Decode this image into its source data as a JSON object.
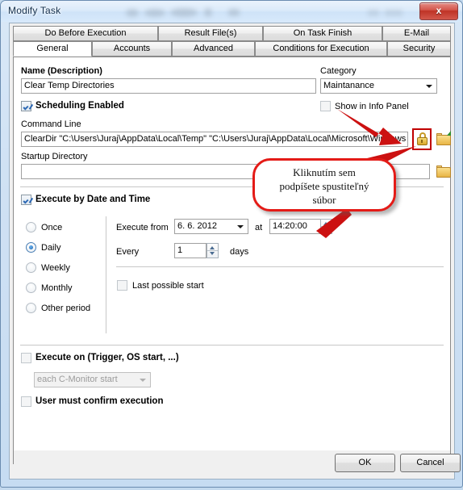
{
  "window": {
    "title": "Modify Task",
    "close_label": "x"
  },
  "tabs": {
    "row_top": [
      {
        "label": "Do Before Execution",
        "active": false
      },
      {
        "label": "Result File(s)",
        "active": false
      },
      {
        "label": "On Task Finish",
        "active": false
      },
      {
        "label": "E-Mail",
        "active": false
      }
    ],
    "row_bottom": [
      {
        "label": "General",
        "active": true
      },
      {
        "label": "Accounts",
        "active": false
      },
      {
        "label": "Advanced",
        "active": false
      },
      {
        "label": "Conditions for Execution",
        "active": false
      },
      {
        "label": "Security",
        "active": false
      }
    ]
  },
  "general": {
    "name_label": "Name (Description)",
    "name_value": "Clear Temp Directories",
    "category_label": "Category",
    "category_value": "Maintanance",
    "scheduling_enabled_label": "Scheduling Enabled",
    "scheduling_enabled_checked": true,
    "show_in_info_panel_label": "Show in Info Panel",
    "show_in_info_panel_checked": false,
    "command_line_label": "Command Line",
    "command_line_value": "ClearDir \"C:\\Users\\Juraj\\AppData\\Local\\Temp\" \"C:\\Users\\Juraj\\AppData\\Local\\Microsoft\\Windows",
    "startup_directory_label": "Startup Directory",
    "startup_directory_value": "",
    "sign_icon": "lock-icon",
    "browse_command_icon": "open-folder-icon",
    "browse_startup_icon": "folder-icon"
  },
  "schedule": {
    "execute_by_date_time_label": "Execute by Date and Time",
    "execute_by_date_time_checked": true,
    "periods": [
      {
        "label": "Once",
        "selected": false
      },
      {
        "label": "Daily",
        "selected": true
      },
      {
        "label": "Weekly",
        "selected": false
      },
      {
        "label": "Monthly",
        "selected": false
      },
      {
        "label": "Other period",
        "selected": false
      }
    ],
    "execute_from_label": "Execute from",
    "execute_from_date": "6.  6. 2012",
    "at_label": "at",
    "at_time": "14:20:00",
    "every_label": "Every",
    "every_value": "1",
    "days_label": "days",
    "last_possible_start_label": "Last possible start",
    "last_possible_start_checked": false
  },
  "triggers": {
    "execute_on_label": "Execute on (Trigger, OS start, ...)",
    "execute_on_checked": false,
    "trigger_value": "each C-Monitor start",
    "user_confirm_label": "User must confirm execution",
    "user_confirm_checked": false
  },
  "buttons": {
    "ok": "OK",
    "cancel": "Cancel"
  },
  "annotation": {
    "callout_line1": "Kliknutím sem",
    "callout_line2": "podpíšete spustiteľný",
    "callout_line3": "súbor",
    "arrow_color": "#cc1111",
    "callout_border_color": "#e41b17"
  }
}
